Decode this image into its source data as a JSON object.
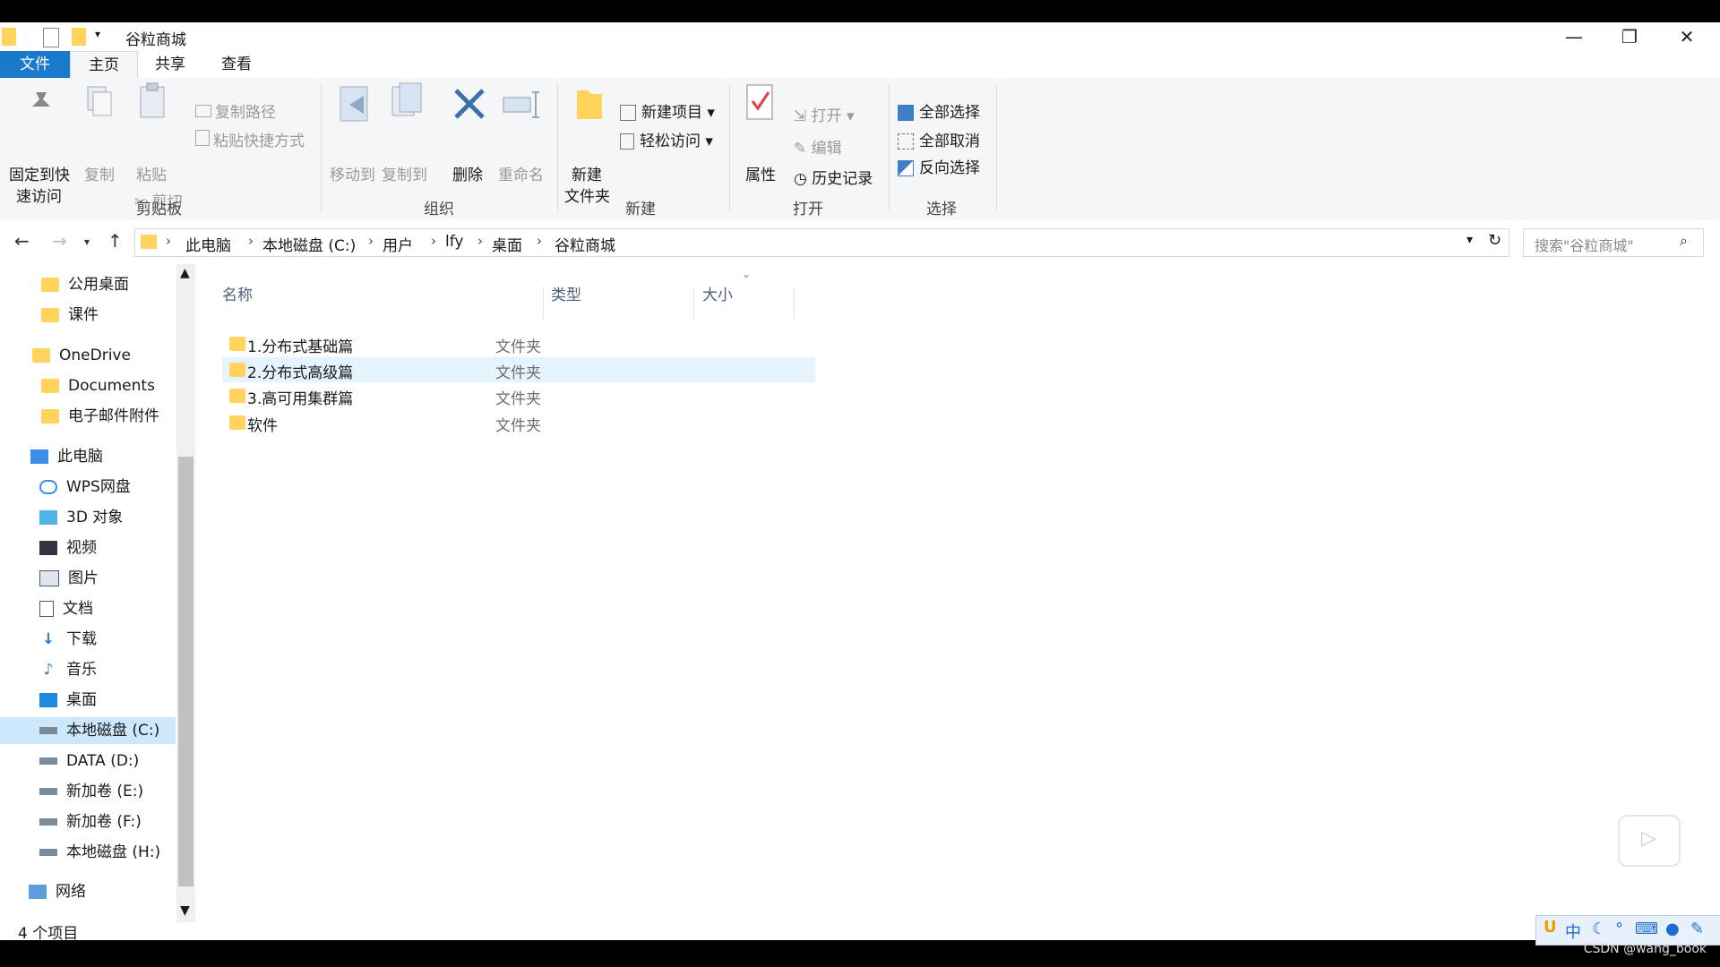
{
  "window": {
    "title": "谷粒商城",
    "controls": {
      "minimize": "—",
      "restore": "❐",
      "close": "✕"
    }
  },
  "tabs": {
    "file": "文件",
    "home": "主页",
    "share": "共享",
    "view": "查看"
  },
  "ribbon": {
    "clipboard": {
      "pin": "固定到快\n速访问",
      "pin_l1": "固定到快",
      "pin_l2": "速访问",
      "copy": "复制",
      "paste": "粘贴",
      "copy_path": "复制路径",
      "paste_shortcut": "粘贴快捷方式",
      "cut": "剪切",
      "label": "剪贴板"
    },
    "organize": {
      "move_to": "移动到",
      "copy_to": "复制到",
      "delete": "删除",
      "rename": "重命名",
      "label": "组织"
    },
    "new": {
      "new_folder_l1": "新建",
      "new_folder_l2": "文件夹",
      "new_item": "新建项目",
      "easy_access": "轻松访问",
      "label": "新建"
    },
    "open": {
      "properties": "属性",
      "open": "打开",
      "edit": "编辑",
      "history": "历史记录",
      "label": "打开"
    },
    "select": {
      "select_all": "全部选择",
      "select_none": "全部取消",
      "invert": "反向选择",
      "label": "选择"
    }
  },
  "address": {
    "crumbs": [
      "此电脑",
      "本地磁盘 (C:)",
      "用户",
      "lfy",
      "桌面",
      "谷粒商城"
    ],
    "search_placeholder": "搜索\"谷粒商城\""
  },
  "nav_pane": {
    "items": [
      {
        "label": "公用桌面",
        "icon": "folder-icon"
      },
      {
        "label": "课件",
        "icon": "folder-icon"
      },
      {
        "label": "OneDrive",
        "icon": "folder-icon"
      },
      {
        "label": "Documents",
        "icon": "folder-icon"
      },
      {
        "label": "电子邮件附件",
        "icon": "folder-icon"
      },
      {
        "label": "此电脑",
        "icon": "computer-icon"
      },
      {
        "label": "WPS网盘",
        "icon": "cloud-icon"
      },
      {
        "label": "3D 对象",
        "icon": "cube-icon"
      },
      {
        "label": "视频",
        "icon": "video-icon"
      },
      {
        "label": "图片",
        "icon": "picture-icon"
      },
      {
        "label": "文档",
        "icon": "document-icon"
      },
      {
        "label": "下载",
        "icon": "download-icon"
      },
      {
        "label": "音乐",
        "icon": "music-icon"
      },
      {
        "label": "桌面",
        "icon": "desktop-icon"
      },
      {
        "label": "本地磁盘 (C:)",
        "icon": "drive-icon"
      },
      {
        "label": "DATA (D:)",
        "icon": "drive-icon"
      },
      {
        "label": "新加卷 (E:)",
        "icon": "drive-icon"
      },
      {
        "label": "新加卷 (F:)",
        "icon": "drive-icon"
      },
      {
        "label": "本地磁盘 (H:)",
        "icon": "drive-icon"
      },
      {
        "label": "网络",
        "icon": "network-icon"
      }
    ]
  },
  "file_list": {
    "columns": {
      "name": "名称",
      "type": "类型",
      "size": "大小"
    },
    "rows": [
      {
        "name": "1.分布式基础篇",
        "type": "文件夹"
      },
      {
        "name": "2.分布式高级篇",
        "type": "文件夹"
      },
      {
        "name": "3.高可用集群篇",
        "type": "文件夹"
      },
      {
        "name": "软件",
        "type": "文件夹"
      }
    ]
  },
  "status": {
    "count": "4 个项目"
  },
  "ime": {
    "lang": "中"
  },
  "watermark": "CSDN @wang_book",
  "colors": {
    "accent": "#1979ca",
    "folder": "#ffd35c",
    "selected": "#cce8ff"
  }
}
